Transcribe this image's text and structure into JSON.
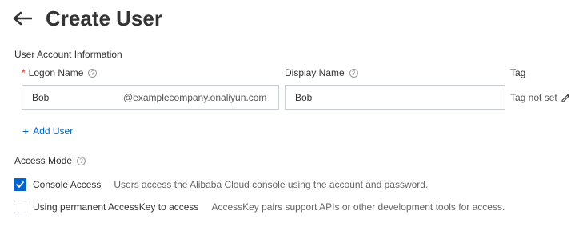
{
  "header": {
    "title": "Create User",
    "back_icon": "arrow-left-icon"
  },
  "account_section": {
    "label": "User Account Information",
    "logon_name": {
      "label": "Logon Name",
      "value": "Bob",
      "suffix": "@examplecompany.onaliyun.com"
    },
    "display_name": {
      "label": "Display Name",
      "value": "Bob"
    },
    "tag": {
      "label": "Tag",
      "value": "Tag not set",
      "edit_icon": "pencil-icon"
    },
    "add_user_label": "Add User"
  },
  "access_mode": {
    "label": "Access Mode",
    "options": [
      {
        "label": "Console Access",
        "description": "Users access the Alibaba Cloud console using the account and password.",
        "checked": true
      },
      {
        "label": "Using permanent AccessKey to access",
        "description": "AccessKey pairs support APIs or other development tools for access.",
        "checked": false
      }
    ]
  },
  "colors": {
    "accent": "#0064c8",
    "required": "#d93026"
  }
}
